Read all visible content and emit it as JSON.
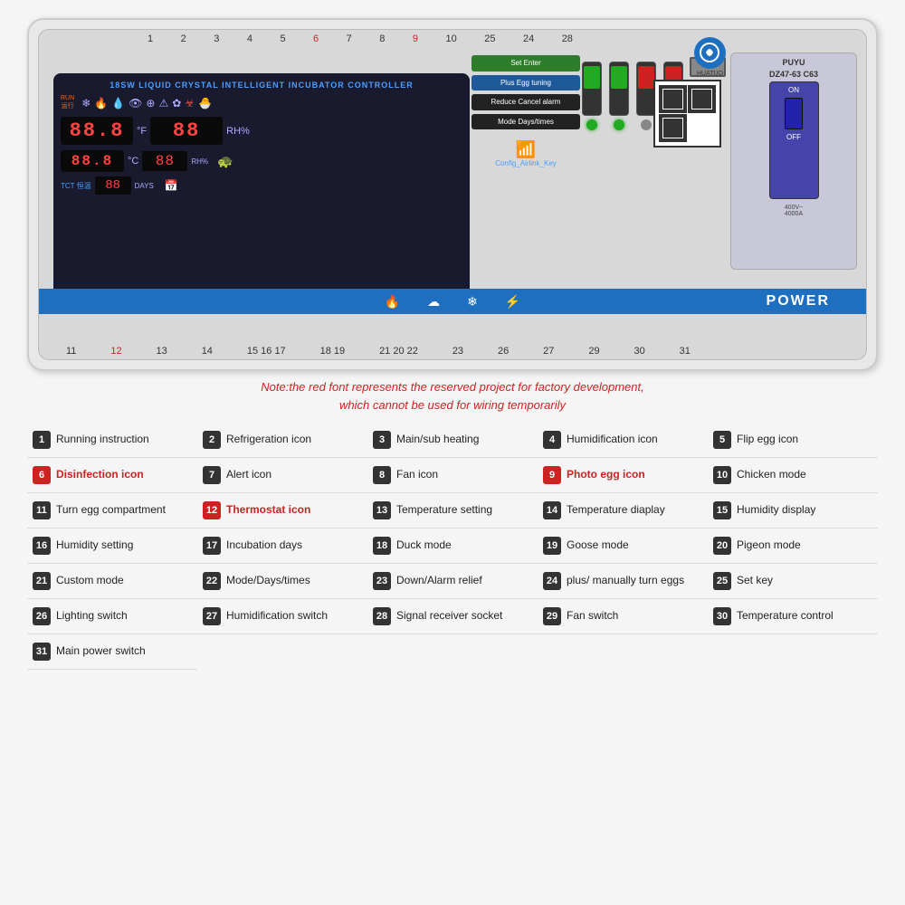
{
  "device": {
    "title": "18SW LIQUID CRYSTAL INTELLIGENT INCUBATOR CONTROLLER",
    "brand": "HUATUO",
    "breaker_model": "DZ47-63 C63",
    "power_label": "POWER",
    "note": "Note:the red font represents the reserved project for factory development,\nwhich cannot be used for wiring temporarily",
    "wifi_label": "Config_Airlink_Key",
    "top_numbers": [
      "1",
      "2",
      "3",
      "4",
      "5",
      "6",
      "7",
      "8",
      "9",
      "10",
      "25",
      "24",
      "28"
    ],
    "bottom_numbers": [
      "11",
      "12",
      "13",
      "14",
      "15",
      "16",
      "17",
      "18",
      "19",
      "21",
      "20",
      "22",
      "23",
      "26",
      "27",
      "29",
      "30",
      "31"
    ]
  },
  "legend": [
    {
      "num": "1",
      "label": "Running instruction",
      "red": false
    },
    {
      "num": "2",
      "label": "Refrigeration icon",
      "red": false
    },
    {
      "num": "3",
      "label": "Main/sub heating",
      "red": false
    },
    {
      "num": "4",
      "label": "Humidification icon",
      "red": false
    },
    {
      "num": "5",
      "label": "Flip egg icon",
      "red": false
    },
    {
      "num": "6",
      "label": "Disinfection icon",
      "red": true
    },
    {
      "num": "7",
      "label": "Alert icon",
      "red": false
    },
    {
      "num": "8",
      "label": "Fan icon",
      "red": false
    },
    {
      "num": "9",
      "label": "Photo egg icon",
      "red": true
    },
    {
      "num": "10",
      "label": "Chicken mode",
      "red": false
    },
    {
      "num": "11",
      "label": "Turn egg compartment",
      "red": false
    },
    {
      "num": "12",
      "label": "Thermostat icon",
      "red": true
    },
    {
      "num": "13",
      "label": "Temperature setting",
      "red": false
    },
    {
      "num": "14",
      "label": "Temperature diaplay",
      "red": false
    },
    {
      "num": "15",
      "label": "Humidity display",
      "red": false
    },
    {
      "num": "16",
      "label": "Humidity setting",
      "red": false
    },
    {
      "num": "17",
      "label": "Incubation days",
      "red": false
    },
    {
      "num": "18",
      "label": "Duck mode",
      "red": false
    },
    {
      "num": "19",
      "label": "Goose mode",
      "red": false
    },
    {
      "num": "20",
      "label": "Pigeon mode",
      "red": false
    },
    {
      "num": "21",
      "label": "Custom mode",
      "red": false
    },
    {
      "num": "22",
      "label": "Mode/Days/times",
      "red": false
    },
    {
      "num": "23",
      "label": "Down/Alarm relief",
      "red": false
    },
    {
      "num": "24",
      "label": "plus/ manually turn eggs",
      "red": false
    },
    {
      "num": "25",
      "label": "Set key",
      "red": false
    },
    {
      "num": "26",
      "label": "Lighting switch",
      "red": false
    },
    {
      "num": "27",
      "label": "Humidification switch",
      "red": false
    },
    {
      "num": "28",
      "label": "Signal receiver socket",
      "red": false
    },
    {
      "num": "29",
      "label": "Fan switch",
      "red": false
    },
    {
      "num": "30",
      "label": "Temperature control",
      "red": false
    },
    {
      "num": "31",
      "label": "Main power switch",
      "red": false
    }
  ],
  "buttons": {
    "set_enter": "Set\nEnter",
    "plus_egg": "Plus\nEgg tuning",
    "reduce_cancel": "Reduce\nCancel alarm",
    "mode_days": "Mode\nDays/times"
  }
}
